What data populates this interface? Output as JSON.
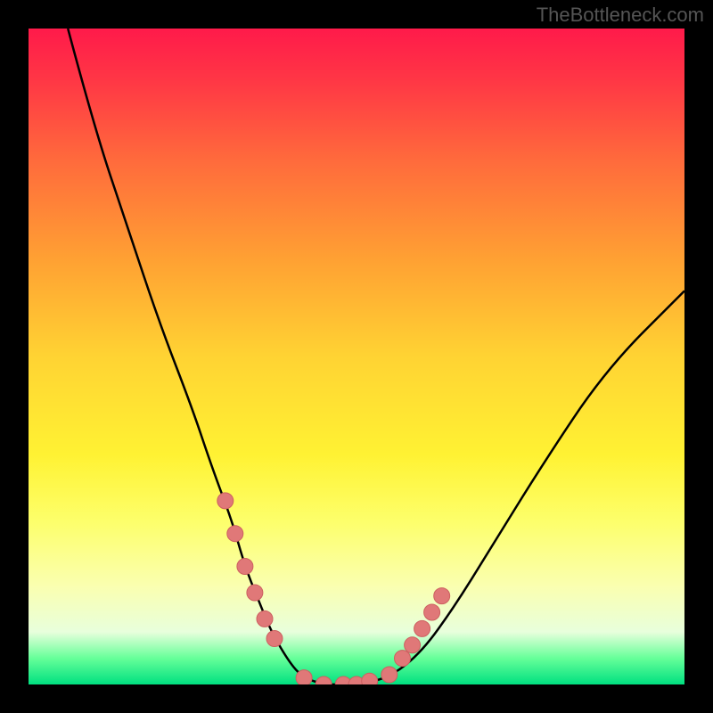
{
  "watermark": "TheBottleneck.com",
  "chart_data": {
    "type": "line",
    "title": "",
    "xlabel": "",
    "ylabel": "",
    "xlim": [
      0,
      100
    ],
    "ylim": [
      0,
      100
    ],
    "series": [
      {
        "name": "bottleneck-curve",
        "x": [
          6,
          10,
          15,
          20,
          25,
          28,
          31,
          33,
          35,
          37,
          40,
          42,
          45,
          48,
          50,
          55,
          60,
          65,
          70,
          78,
          88,
          100
        ],
        "y": [
          100,
          85,
          70,
          55,
          42,
          33,
          25,
          18,
          13,
          8,
          3,
          1,
          0,
          0,
          0,
          1,
          5,
          12,
          20,
          33,
          48,
          60
        ]
      }
    ],
    "markers": {
      "name": "highlight-points",
      "x": [
        30,
        31.5,
        33,
        34.5,
        36,
        37.5,
        42,
        45,
        48,
        50,
        52,
        55,
        57,
        58.5,
        60,
        61.5,
        63
      ],
      "y": [
        28,
        23,
        18,
        14,
        10,
        7,
        1,
        0,
        0,
        0,
        0.5,
        1.5,
        4,
        6,
        8.5,
        11,
        13.5
      ]
    },
    "gradient_stops": [
      {
        "pos": 0,
        "color": "#ff1a4a"
      },
      {
        "pos": 50,
        "color": "#ffd333"
      },
      {
        "pos": 100,
        "color": "#00e080"
      }
    ]
  }
}
